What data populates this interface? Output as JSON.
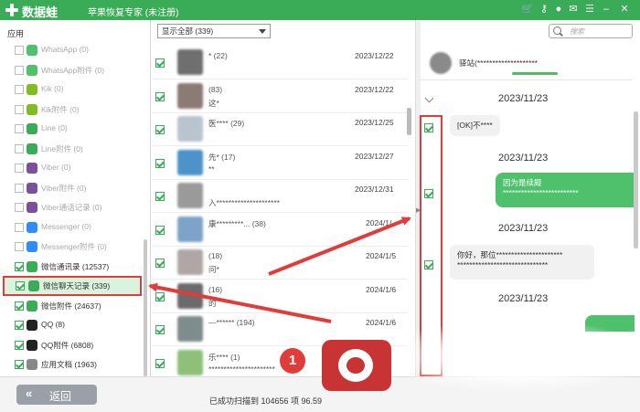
{
  "app": {
    "name": "数据蛙",
    "subtitle": "苹果恢复专家 (未注册)",
    "titlebar_icons": [
      "cart-icon",
      "key-icon",
      "chat-icon",
      "mail-icon",
      "menu-icon",
      "minimize-icon",
      "close-icon"
    ]
  },
  "sidebar": {
    "heading": "应用",
    "items": [
      {
        "label": "WhatsApp (0)",
        "checked": false,
        "icon": "whatsapp-icon",
        "color": "#4fc16d"
      },
      {
        "label": "WhatsApp附件 (0)",
        "checked": false,
        "icon": "whatsapp-icon",
        "color": "#4fc16d"
      },
      {
        "label": "Kik (0)",
        "checked": false,
        "icon": "kik-icon",
        "color": "#82bc23"
      },
      {
        "label": "Kik附件 (0)",
        "checked": false,
        "icon": "kik-icon",
        "color": "#82bc23"
      },
      {
        "label": "Line (0)",
        "checked": false,
        "icon": "line-icon",
        "color": "#3aab57"
      },
      {
        "label": "Line附件 (0)",
        "checked": false,
        "icon": "line-icon",
        "color": "#3aab57"
      },
      {
        "label": "Viber (0)",
        "checked": false,
        "icon": "viber-icon",
        "color": "#7b519d"
      },
      {
        "label": "Viber附件 (0)",
        "checked": false,
        "icon": "viber-icon",
        "color": "#7b519d"
      },
      {
        "label": "Viber通话记录 (0)",
        "checked": false,
        "icon": "viber-icon",
        "color": "#7b519d"
      },
      {
        "label": "Messenger (0)",
        "checked": false,
        "icon": "messenger-icon",
        "color": "#2d8cff"
      },
      {
        "label": "Messenger附件 (0)",
        "checked": false,
        "icon": "messenger-icon",
        "color": "#2d8cff"
      },
      {
        "label": "微信通讯录 (12537)",
        "checked": true,
        "icon": "wechat-icon",
        "color": "#3aab57"
      },
      {
        "label": "微信聊天记录 (339)",
        "checked": true,
        "icon": "wechat-icon",
        "color": "#3aab57",
        "selected": true
      },
      {
        "label": "微信附件 (24637)",
        "checked": true,
        "icon": "wechat-icon",
        "color": "#3aab57"
      },
      {
        "label": "QQ (8)",
        "checked": true,
        "icon": "qq-icon",
        "color": "#222222"
      },
      {
        "label": "QQ附件 (6808)",
        "checked": true,
        "icon": "qq-icon",
        "color": "#222222"
      },
      {
        "label": "应用文档 (1963)",
        "checked": true,
        "icon": "document-icon",
        "color": "#888888"
      }
    ]
  },
  "list": {
    "filter": "显示全部 (339)",
    "rows": [
      {
        "name": "*  (22)",
        "preview": "",
        "date": "2023/12/22",
        "avatar": "#6f6f6f"
      },
      {
        "name": "(83)",
        "preview": "这*",
        "date": "2023/12/22",
        "avatar": "#8c7b74"
      },
      {
        "name": "医**** (29)",
        "preview": "",
        "date": "2023/12/25",
        "avatar": "#b9c4cf"
      },
      {
        "name": "先* (17)",
        "preview": "**",
        "date": "2023/12/27",
        "avatar": "#4c93c9"
      },
      {
        "name": "",
        "preview": "入*********************",
        "date": "2023/12/31",
        "avatar": "#9a9a9a"
      },
      {
        "name": "康*********...  (38)",
        "preview": "",
        "date": "2024/1/",
        "avatar": "#7da4c8"
      },
      {
        "name": "(18)",
        "preview": "问*",
        "date": "2024/1/5",
        "avatar": "#b0a6a6"
      },
      {
        "name": "(16)",
        "preview": "的",
        "date": "2024/1/6",
        "avatar": "#6b6b6b"
      },
      {
        "name": "—******  (194)",
        "preview": "",
        "date": "2024/1/6",
        "avatar": "#7f8c8d"
      },
      {
        "name": "乐**** (1)",
        "preview": "**********************",
        "date": "",
        "avatar": "#8ec07a"
      }
    ]
  },
  "chat": {
    "search_placeholder": "搜索",
    "title": "驿站(********************",
    "stamps": [
      "2023/11/23",
      "2023/11/23",
      "2023/11/23",
      "2023/11/23"
    ],
    "messages": [
      {
        "direction": "in",
        "line1": "[OK]不****",
        "line2": ""
      },
      {
        "direction": "out",
        "line1": "因为是续殿",
        "line2": "*************************"
      },
      {
        "direction": "in",
        "line1": "你好，那位**********************",
        "line2": "******************************"
      }
    ]
  },
  "footer": {
    "back_label": "返回",
    "status": "已成功扫描到 104656 项 96.59"
  },
  "annotations": {
    "step_number": "1",
    "highlight_color": "#e03c3c"
  }
}
